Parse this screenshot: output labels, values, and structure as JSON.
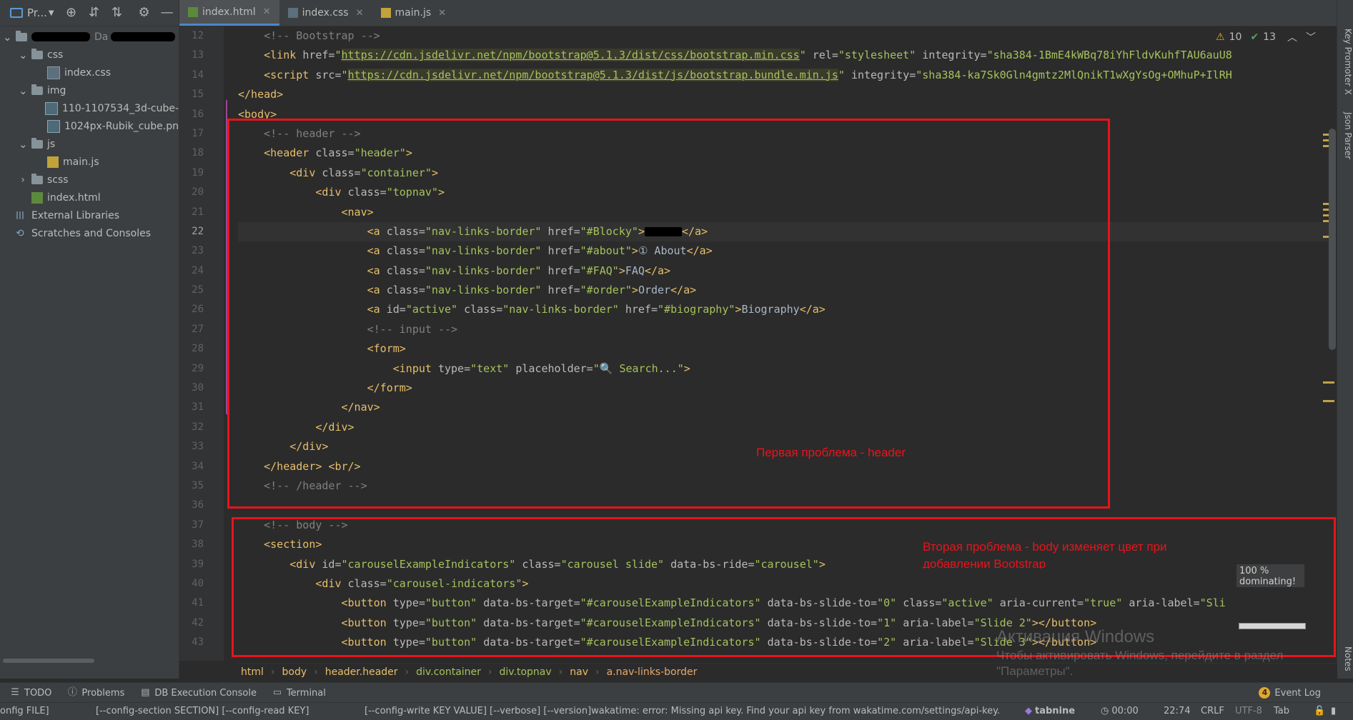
{
  "project_panel": {
    "title": "Pr...",
    "tree": [
      {
        "label": "Da",
        "level": 0,
        "type": "root",
        "expanded": true
      },
      {
        "label": "css",
        "level": 1,
        "type": "folder",
        "expanded": true
      },
      {
        "label": "index.css",
        "level": 2,
        "type": "css"
      },
      {
        "label": "img",
        "level": 1,
        "type": "folder",
        "expanded": true
      },
      {
        "label": "110-1107534_3d-cube-",
        "level": 2,
        "type": "img"
      },
      {
        "label": "1024px-Rubik_cube.pn",
        "level": 2,
        "type": "img"
      },
      {
        "label": "js",
        "level": 1,
        "type": "folder",
        "expanded": true
      },
      {
        "label": "main.js",
        "level": 2,
        "type": "js"
      },
      {
        "label": "scss",
        "level": 1,
        "type": "folder",
        "expanded": false
      },
      {
        "label": "index.html",
        "level": 1,
        "type": "html"
      },
      {
        "label": "External Libraries",
        "level": 0,
        "type": "libs"
      },
      {
        "label": "Scratches and Consoles",
        "level": 0,
        "type": "scratch"
      }
    ]
  },
  "tabs": [
    {
      "label": "index.html",
      "type": "html",
      "active": true
    },
    {
      "label": "index.css",
      "type": "css",
      "active": false
    },
    {
      "label": "main.js",
      "type": "js",
      "active": false
    }
  ],
  "inspection": {
    "warnings": "10",
    "weak": "13"
  },
  "editor": {
    "current_line": 22,
    "lines": [
      {
        "n": "12",
        "tokens": [
          [
            "    ",
            "t"
          ],
          [
            "<!-- Bootstrap -->",
            "cm"
          ]
        ]
      },
      {
        "n": "13",
        "tokens": [
          [
            "    ",
            "t"
          ],
          [
            "<link ",
            "tag"
          ],
          [
            "href=",
            "attr"
          ],
          [
            "\"",
            "val"
          ],
          [
            "https://cdn.jsdelivr.net/npm/bootstrap@5.1.3/dist/css/bootstrap.min.css",
            "url"
          ],
          [
            "\" ",
            "val"
          ],
          [
            "rel=",
            "attr"
          ],
          [
            "\"stylesheet\" ",
            "val"
          ],
          [
            "integrity=",
            "attr"
          ],
          [
            "\"sha384-1BmE4kWBq78iYhFldvKuhfTAU6auU8",
            "val"
          ]
        ]
      },
      {
        "n": "14",
        "tokens": [
          [
            "    ",
            "t"
          ],
          [
            "<script ",
            "tag"
          ],
          [
            "src=",
            "attr"
          ],
          [
            "\"",
            "val"
          ],
          [
            "https://cdn.jsdelivr.net/npm/bootstrap@5.1.3/dist/js/bootstrap.bundle.min.js",
            "url"
          ],
          [
            "\" ",
            "val"
          ],
          [
            "integrity=",
            "attr"
          ],
          [
            "\"sha384-ka7Sk0Gln4gmtz2MlQnikT1wXgYsOg+OMhuP+IlRH",
            "val"
          ]
        ]
      },
      {
        "n": "15",
        "tokens": [
          [
            "</head>",
            "tag"
          ]
        ]
      },
      {
        "n": "16",
        "tokens": [
          [
            "<body>",
            "tag"
          ]
        ]
      },
      {
        "n": "17",
        "tokens": [
          [
            "    ",
            "t"
          ],
          [
            "<!-- header -->",
            "cm"
          ]
        ]
      },
      {
        "n": "18",
        "tokens": [
          [
            "    ",
            "t"
          ],
          [
            "<header ",
            "tag"
          ],
          [
            "class=",
            "attr"
          ],
          [
            "\"header\"",
            "val"
          ],
          [
            ">",
            "tag"
          ]
        ]
      },
      {
        "n": "19",
        "tokens": [
          [
            "        ",
            "t"
          ],
          [
            "<div ",
            "tag"
          ],
          [
            "class=",
            "attr"
          ],
          [
            "\"container\"",
            "val"
          ],
          [
            ">",
            "tag"
          ]
        ]
      },
      {
        "n": "20",
        "tokens": [
          [
            "            ",
            "t"
          ],
          [
            "<div ",
            "tag"
          ],
          [
            "class=",
            "attr"
          ],
          [
            "\"topnav\"",
            "val"
          ],
          [
            ">",
            "tag"
          ]
        ]
      },
      {
        "n": "21",
        "tokens": [
          [
            "                ",
            "t"
          ],
          [
            "<nav>",
            "tag"
          ]
        ]
      },
      {
        "n": "22",
        "tokens": [
          [
            "                    ",
            "t"
          ],
          [
            "<a ",
            "tag"
          ],
          [
            "class=",
            "attr"
          ],
          [
            "\"nav-links-border\" ",
            "val"
          ],
          [
            "href=",
            "attr"
          ],
          [
            "\"#Blocky\"",
            "val"
          ],
          [
            ">",
            "tag"
          ],
          [
            "      ",
            "redact"
          ],
          [
            "</a>",
            "tag"
          ]
        ]
      },
      {
        "n": "23",
        "tokens": [
          [
            "                    ",
            "t"
          ],
          [
            "<a ",
            "tag"
          ],
          [
            "class=",
            "attr"
          ],
          [
            "\"nav-links-border\" ",
            "val"
          ],
          [
            "href=",
            "attr"
          ],
          [
            "\"#about\"",
            "val"
          ],
          [
            ">",
            "tag"
          ],
          [
            "① About",
            "t"
          ],
          [
            "</a>",
            "tag"
          ]
        ]
      },
      {
        "n": "24",
        "tokens": [
          [
            "                    ",
            "t"
          ],
          [
            "<a ",
            "tag"
          ],
          [
            "class=",
            "attr"
          ],
          [
            "\"nav-links-border\" ",
            "val"
          ],
          [
            "href=",
            "attr"
          ],
          [
            "\"#FAQ\"",
            "val"
          ],
          [
            ">",
            "tag"
          ],
          [
            "FAQ",
            "t"
          ],
          [
            "</a>",
            "tag"
          ]
        ]
      },
      {
        "n": "25",
        "tokens": [
          [
            "                    ",
            "t"
          ],
          [
            "<a ",
            "tag"
          ],
          [
            "class=",
            "attr"
          ],
          [
            "\"nav-links-border\" ",
            "val"
          ],
          [
            "href=",
            "attr"
          ],
          [
            "\"#order\"",
            "val"
          ],
          [
            ">",
            "tag"
          ],
          [
            "Order",
            "t"
          ],
          [
            "</a>",
            "tag"
          ]
        ]
      },
      {
        "n": "26",
        "tokens": [
          [
            "                    ",
            "t"
          ],
          [
            "<a ",
            "tag"
          ],
          [
            "id=",
            "attr"
          ],
          [
            "\"active\" ",
            "val"
          ],
          [
            "class=",
            "attr"
          ],
          [
            "\"nav-links-border\" ",
            "val"
          ],
          [
            "href=",
            "attr"
          ],
          [
            "\"#biography\"",
            "val"
          ],
          [
            ">",
            "tag"
          ],
          [
            "Biography",
            "t"
          ],
          [
            "</a>",
            "tag"
          ]
        ]
      },
      {
        "n": "27",
        "tokens": [
          [
            "                    ",
            "t"
          ],
          [
            "<!-- input -->",
            "cm"
          ]
        ]
      },
      {
        "n": "28",
        "tokens": [
          [
            "                    ",
            "t"
          ],
          [
            "<form>",
            "tag"
          ]
        ]
      },
      {
        "n": "29",
        "tokens": [
          [
            "                        ",
            "t"
          ],
          [
            "<input ",
            "tag"
          ],
          [
            "type=",
            "attr"
          ],
          [
            "\"text\" ",
            "val"
          ],
          [
            "placeholder=",
            "attr"
          ],
          [
            "\"🔍 Search...\"",
            "val"
          ],
          [
            ">",
            "tag"
          ]
        ]
      },
      {
        "n": "30",
        "tokens": [
          [
            "                    ",
            "t"
          ],
          [
            "</form>",
            "tag"
          ]
        ]
      },
      {
        "n": "31",
        "tokens": [
          [
            "                ",
            "t"
          ],
          [
            "</nav>",
            "tag"
          ]
        ]
      },
      {
        "n": "32",
        "tokens": [
          [
            "            ",
            "t"
          ],
          [
            "</div>",
            "tag"
          ]
        ]
      },
      {
        "n": "33",
        "tokens": [
          [
            "        ",
            "t"
          ],
          [
            "</div>",
            "tag"
          ]
        ]
      },
      {
        "n": "34",
        "tokens": [
          [
            "    ",
            "t"
          ],
          [
            "</header>",
            "tag"
          ],
          [
            " ",
            "t"
          ],
          [
            "<br/>",
            "tag"
          ]
        ]
      },
      {
        "n": "35",
        "tokens": [
          [
            "    ",
            "t"
          ],
          [
            "<!-- /header -->",
            "cm"
          ]
        ]
      },
      {
        "n": "36",
        "tokens": [
          [
            "",
            "t"
          ]
        ]
      },
      {
        "n": "37",
        "tokens": [
          [
            "    ",
            "t"
          ],
          [
            "<!-- body -->",
            "cm"
          ]
        ]
      },
      {
        "n": "38",
        "tokens": [
          [
            "    ",
            "t"
          ],
          [
            "<section>",
            "tag"
          ]
        ]
      },
      {
        "n": "39",
        "tokens": [
          [
            "        ",
            "t"
          ],
          [
            "<div ",
            "tag"
          ],
          [
            "id=",
            "attr"
          ],
          [
            "\"carouselExampleIndicators\" ",
            "val"
          ],
          [
            "class=",
            "attr"
          ],
          [
            "\"carousel slide\" ",
            "val"
          ],
          [
            "data-bs-ride=",
            "attr"
          ],
          [
            "\"carousel\"",
            "val"
          ],
          [
            ">",
            "tag"
          ]
        ]
      },
      {
        "n": "40",
        "tokens": [
          [
            "            ",
            "t"
          ],
          [
            "<div ",
            "tag"
          ],
          [
            "class=",
            "attr"
          ],
          [
            "\"carousel-indicators\"",
            "val"
          ],
          [
            ">",
            "tag"
          ]
        ]
      },
      {
        "n": "41",
        "tokens": [
          [
            "                ",
            "t"
          ],
          [
            "<button ",
            "tag"
          ],
          [
            "type=",
            "attr"
          ],
          [
            "\"button\" ",
            "val"
          ],
          [
            "data-bs-target=",
            "attr"
          ],
          [
            "\"#carouselExampleIndicators\" ",
            "val"
          ],
          [
            "data-bs-slide-to=",
            "attr"
          ],
          [
            "\"0\" ",
            "val"
          ],
          [
            "class=",
            "attr"
          ],
          [
            "\"active\" ",
            "val"
          ],
          [
            "aria-current=",
            "attr"
          ],
          [
            "\"true\" ",
            "val"
          ],
          [
            "aria-label=",
            "attr"
          ],
          [
            "\"Sli",
            "val"
          ]
        ]
      },
      {
        "n": "42",
        "tokens": [
          [
            "                ",
            "t"
          ],
          [
            "<button ",
            "tag"
          ],
          [
            "type=",
            "attr"
          ],
          [
            "\"button\" ",
            "val"
          ],
          [
            "data-bs-target=",
            "attr"
          ],
          [
            "\"#carouselExampleIndicators\" ",
            "val"
          ],
          [
            "data-bs-slide-to=",
            "attr"
          ],
          [
            "\"1\" ",
            "val"
          ],
          [
            "aria-label=",
            "attr"
          ],
          [
            "\"Slide 2\"",
            "val"
          ],
          [
            "></button>",
            "tag"
          ]
        ]
      },
      {
        "n": "43",
        "tokens": [
          [
            "                ",
            "t"
          ],
          [
            "<button ",
            "tag"
          ],
          [
            "type=",
            "attr"
          ],
          [
            "\"button\" ",
            "val"
          ],
          [
            "data-bs-target=",
            "attr"
          ],
          [
            "\"#carouselExampleIndicators\" ",
            "val"
          ],
          [
            "data-bs-slide-to=",
            "attr"
          ],
          [
            "\"2\" ",
            "val"
          ],
          [
            "aria-label=",
            "attr"
          ],
          [
            "\"Slide 3\"",
            "val"
          ],
          [
            "></button>",
            "tag"
          ]
        ]
      }
    ]
  },
  "annotations": {
    "problem1": "Первая проблема - header",
    "problem2_line1": "Вторая проблема - body изменяет цвет при",
    "problem2_line2": "добавлении Bootstrap"
  },
  "popup": {
    "line1": "100 %",
    "line2": "dominating!"
  },
  "watermark": {
    "title": "Активация Windows",
    "line1": "Чтобы активировать Windows, перейдите в раздел",
    "line2": "\"Параметры\"."
  },
  "breadcrumbs": [
    "html",
    "body",
    "header.header",
    "div.container",
    "div.topnav",
    "nav",
    "a.nav-links-border"
  ],
  "right_tabs": [
    "Key Promoter X",
    "Json Parser",
    "Notes"
  ],
  "bottom_tools": [
    {
      "label": "TODO",
      "icon": "list-icon"
    },
    {
      "label": "Problems",
      "icon": "info-icon"
    },
    {
      "label": "DB Execution Console",
      "icon": "console-icon"
    },
    {
      "label": "Terminal",
      "icon": "terminal-icon"
    }
  ],
  "event_log": {
    "count": "4",
    "label": "Event Log"
  },
  "status": {
    "left": "onfig FILE]",
    "mid1": "[--config-section SECTION] [--config-read KEY]",
    "mid2": "[--config-write KEY VALUE] [--verbose] [--version]wakatime: error: Missing api key. Find your api key from wakatime.com/settings/api-key.",
    "tabnine": "tabnine",
    "time": "00:00",
    "position": "22:74",
    "line_sep": "CRLF",
    "encoding": "UTF-8",
    "indent": "Tab"
  },
  "colors": {
    "annotation_red": "#e8141b",
    "accent": "#4a88c7",
    "warning": "#e2a72e"
  }
}
